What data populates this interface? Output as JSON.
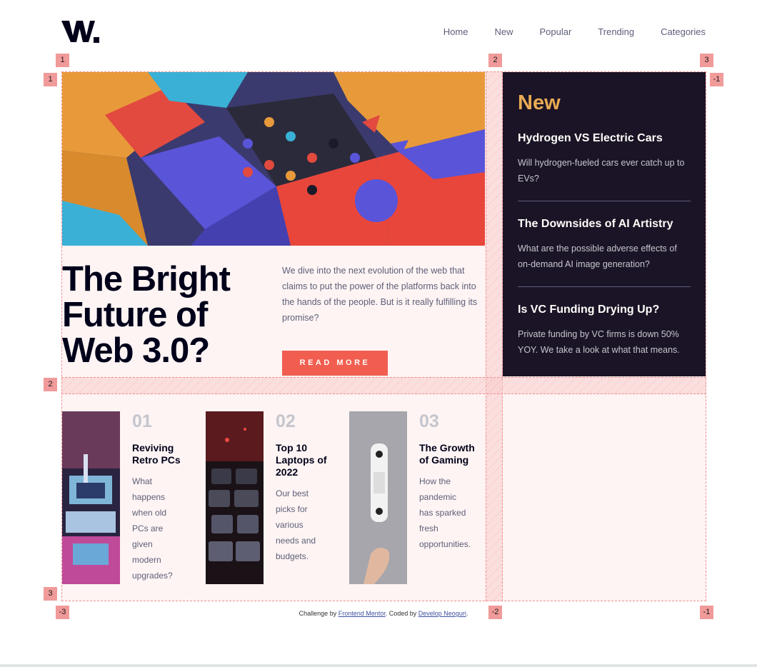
{
  "header": {
    "logo_alt": "W.",
    "nav": [
      "Home",
      "New",
      "Popular",
      "Trending",
      "Categories"
    ]
  },
  "hero": {
    "title": "The Bright Future of Web 3.0?",
    "description": "We dive into the next evolution of the web that claims to put the power of the platforms back into the hands of the people. But is it really fulfilling its promise?",
    "button": "READ MORE"
  },
  "new_panel": {
    "heading": "New",
    "items": [
      {
        "title": "Hydrogen VS Electric Cars",
        "text": "Will hydrogen-fueled cars ever catch up to EVs?"
      },
      {
        "title": "The Downsides of AI Artistry",
        "text": "What are the possible adverse effects of on-demand AI image generation?"
      },
      {
        "title": "Is VC Funding Drying Up?",
        "text": "Private funding by VC firms is down 50% YOY. We take a look at what that means."
      }
    ]
  },
  "cards": [
    {
      "num": "01",
      "title": "Reviving Retro PCs",
      "text": "What happens when old PCs are given modern upgrades?"
    },
    {
      "num": "02",
      "title": "Top 10 Laptops of 2022",
      "text": "Our best picks for various needs and budgets."
    },
    {
      "num": "03",
      "title": "The Growth of Gaming",
      "text": "How the pandemic has sparked fresh opportunities."
    }
  ],
  "grid_badges": {
    "top": [
      "1",
      "2",
      "3"
    ],
    "left": [
      "1",
      "2",
      "3"
    ],
    "bottom": [
      "-3",
      "-2",
      "-1"
    ],
    "right_top": "-1"
  },
  "footer": {
    "prefix": "Challenge by ",
    "link1": "Frontend Mentor",
    "middle": ". Coded by ",
    "link2": "Develop Neoguri",
    "suffix": "."
  },
  "colors": {
    "accent": "#f15e50",
    "panel_bg": "#1b1426",
    "new_heading": "#e9ab53",
    "page_bg": "#fdf4f3"
  }
}
